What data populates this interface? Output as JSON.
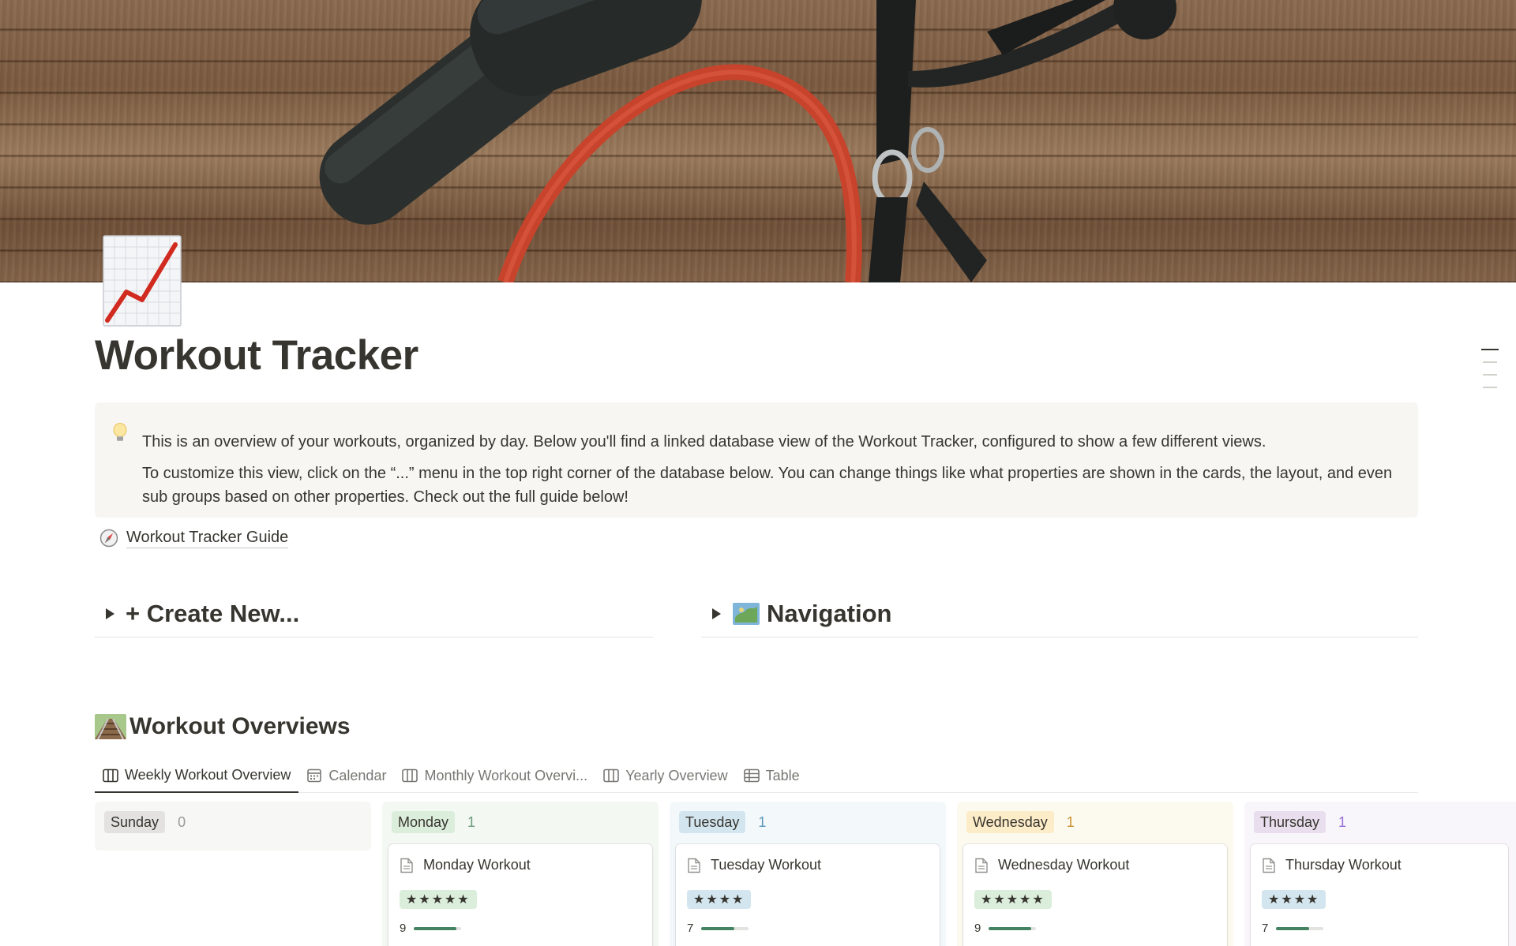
{
  "page": {
    "title": "Workout Tracker",
    "icon": "chart-increasing-icon"
  },
  "callout": {
    "icon": "light-bulb-icon",
    "line1": "This is an overview of your workouts, organized by day. Below you'll find a linked database view of the Workout Tracker, configured to show a few different views.",
    "line2": "To customize this view, click on the “...” menu in the top right corner of the database below. You can change things like what properties are shown in the cards, the layout, and even sub groups based on other properties. Check out the full guide below!"
  },
  "guide_link": {
    "icon": "compass-icon",
    "label": "Workout Tracker Guide"
  },
  "toggles": {
    "create": "+ Create New...",
    "navigation": "Navigation",
    "navigation_icon": "map-icon"
  },
  "section": {
    "title": "Workout Overviews",
    "icon": "railway-track-icon"
  },
  "tabs": [
    {
      "label": "Weekly Workout Overview",
      "icon": "board-icon",
      "active": true
    },
    {
      "label": "Calendar",
      "icon": "calendar-icon",
      "active": false
    },
    {
      "label": "Monthly Workout Overvi...",
      "icon": "board-icon",
      "active": false
    },
    {
      "label": "Yearly Overview",
      "icon": "board-icon",
      "active": false
    },
    {
      "label": "Table",
      "icon": "table-icon",
      "active": false
    }
  ],
  "columns": [
    {
      "name": "Sunday",
      "count": "0",
      "pill_bg": "#e3e2e0",
      "col_bg": "#f7f7f5",
      "count_color": "#9b9a97",
      "card": null
    },
    {
      "name": "Monday",
      "count": "1",
      "pill_bg": "#dbeddb",
      "col_bg": "#f4f8f3",
      "count_color": "#6c9b7d",
      "card": {
        "title": "Monday Workout",
        "stars": "★★★★★",
        "value": "9",
        "progress": 0.9
      }
    },
    {
      "name": "Tuesday",
      "count": "1",
      "pill_bg": "#d3e5ef",
      "col_bg": "#f3f8fb",
      "count_color": "#5b97bd",
      "card": {
        "title": "Tuesday Workout",
        "stars": "★★★★",
        "value": "7",
        "progress": 0.7
      }
    },
    {
      "name": "Wednesday",
      "count": "1",
      "pill_bg": "#fdecc8",
      "col_bg": "#fcf9ef",
      "count_color": "#cb912f",
      "card": {
        "title": "Wednesday Workout",
        "stars": "★★★★★",
        "value": "9",
        "progress": 0.9
      }
    },
    {
      "name": "Thursday",
      "count": "1",
      "pill_bg": "#e8deee",
      "col_bg": "#f9f6fb",
      "count_color": "#9a6dd7",
      "card": {
        "title": "Thursday Workout",
        "stars": "★★★★",
        "value": "7",
        "progress": 0.7
      }
    }
  ]
}
